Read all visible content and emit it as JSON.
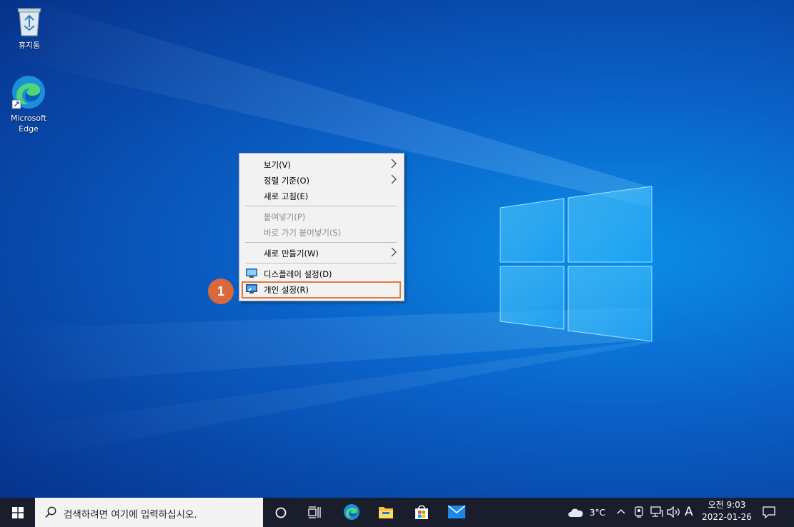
{
  "desktop": {
    "icons": [
      {
        "label": "휴지통",
        "icon": "recycle-bin-icon"
      },
      {
        "label_line1": "Microsoft",
        "label_line2": "Edge",
        "icon": "edge-icon"
      }
    ]
  },
  "context_menu": {
    "items": [
      {
        "label": "보기(V)",
        "submenu": true,
        "enabled": true
      },
      {
        "label": "정렬 기준(O)",
        "submenu": true,
        "enabled": true
      },
      {
        "label": "새로 고침(E)",
        "submenu": false,
        "enabled": true
      },
      {
        "label": "붙여넣기(P)",
        "submenu": false,
        "enabled": false
      },
      {
        "label": "바로 가기 붙여넣기(S)",
        "submenu": false,
        "enabled": false
      },
      {
        "label": "새로 만들기(W)",
        "submenu": true,
        "enabled": true
      },
      {
        "label": "디스플레이 설정(D)",
        "submenu": false,
        "enabled": true,
        "icon": "display-icon"
      },
      {
        "label": "개인 설정(R)",
        "submenu": false,
        "enabled": true,
        "icon": "personalize-icon",
        "highlighted": true
      }
    ]
  },
  "annotation": {
    "step": "1",
    "color": "#d9683d"
  },
  "taskbar": {
    "search_placeholder": "검색하려면 여기에 입력하십시오.",
    "weather": "3°C",
    "ime": "A",
    "time": "오전 9:03",
    "date": "2022-01-26",
    "pinned": [
      "edge-icon",
      "file-explorer-icon",
      "store-icon",
      "mail-icon"
    ]
  },
  "colors": {
    "accent": "#e07a40",
    "taskbar_bg": "#1a1d2b",
    "menu_bg": "#f2f2f2"
  }
}
